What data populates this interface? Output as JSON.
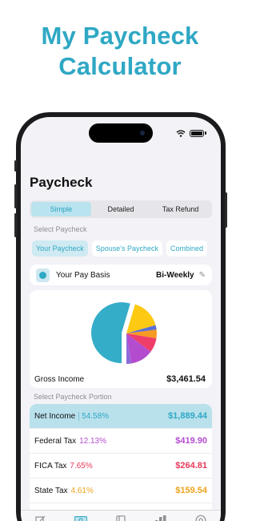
{
  "headline": {
    "line1": "My Paycheck",
    "line2": "Calculator"
  },
  "screen": {
    "title": "Paycheck",
    "mode_tabs": [
      {
        "label": "Simple",
        "active": true
      },
      {
        "label": "Detailed",
        "active": false
      },
      {
        "label": "Tax Refund",
        "active": false
      }
    ],
    "select_paycheck_label": "Select Paycheck",
    "paycheck_tabs": [
      {
        "label": "Your Paycheck",
        "active": true
      },
      {
        "label": "Spouse's Paycheck",
        "active": false
      },
      {
        "label": "Combined",
        "active": false
      }
    ],
    "pay_basis": {
      "label": "Your Pay Basis",
      "value": "Bi-Weekly",
      "icon": "clock-icon",
      "edit_icon": "pencil-icon"
    },
    "gross": {
      "label": "Gross Income",
      "value": "$3,461.54"
    },
    "select_portion_label": "Select Paycheck Portion",
    "portions": [
      {
        "label": "Net Income",
        "pct": "54.58%",
        "amount": "$1,889.44",
        "color": "#2fa8c4",
        "selected": true
      },
      {
        "label": "Federal Tax",
        "pct": "12.13%",
        "amount": "$419.90",
        "color": "#b44ccf",
        "selected": false
      },
      {
        "label": "FICA Tax",
        "pct": "7.65%",
        "amount": "$264.81",
        "color": "#e83a5a",
        "selected": false
      },
      {
        "label": "State Tax",
        "pct": "4.61%",
        "amount": "$159.54",
        "color": "#f0a21c",
        "selected": false
      }
    ],
    "pie_slices": [
      {
        "name": "Net Income",
        "value": 54.58,
        "color": "#34adc8",
        "offset": 6
      },
      {
        "name": "Yellow",
        "value": 16.0,
        "color": "#fdc913",
        "offset": 0
      },
      {
        "name": "Blue",
        "value": 2.4,
        "color": "#5c6fd6",
        "offset": 0
      },
      {
        "name": "State Tax",
        "value": 4.61,
        "color": "#f59a23",
        "offset": 0
      },
      {
        "name": "FICA Tax",
        "value": 7.65,
        "color": "#ef3d6a",
        "offset": 0
      },
      {
        "name": "Federal Tax",
        "value": 12.13,
        "color": "#b44ccf",
        "offset": 0
      },
      {
        "name": "Other",
        "value": 2.63,
        "color": "#8e6ad8",
        "offset": 0
      }
    ],
    "tabbar_icons": [
      "edit-icon",
      "money-icon",
      "document-icon",
      "chart-icon",
      "settings-icon"
    ]
  }
}
